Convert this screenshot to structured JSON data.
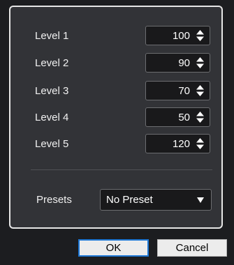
{
  "levels": [
    {
      "label": "Level 1",
      "value": "100"
    },
    {
      "label": "Level 2",
      "value": "90"
    },
    {
      "label": "Level 3",
      "value": "70"
    },
    {
      "label": "Level 4",
      "value": "50"
    },
    {
      "label": "Level 5",
      "value": "120"
    }
  ],
  "presets": {
    "label": "Presets",
    "value": "No Preset"
  },
  "buttons": {
    "ok": "OK",
    "cancel": "Cancel"
  },
  "icons": {
    "stepper": "up-down-arrows-icon",
    "dropdown": "triangle-down-icon"
  },
  "colors": {
    "focus_border": "#1e78d6",
    "panel_border": "#e6e6e6"
  }
}
